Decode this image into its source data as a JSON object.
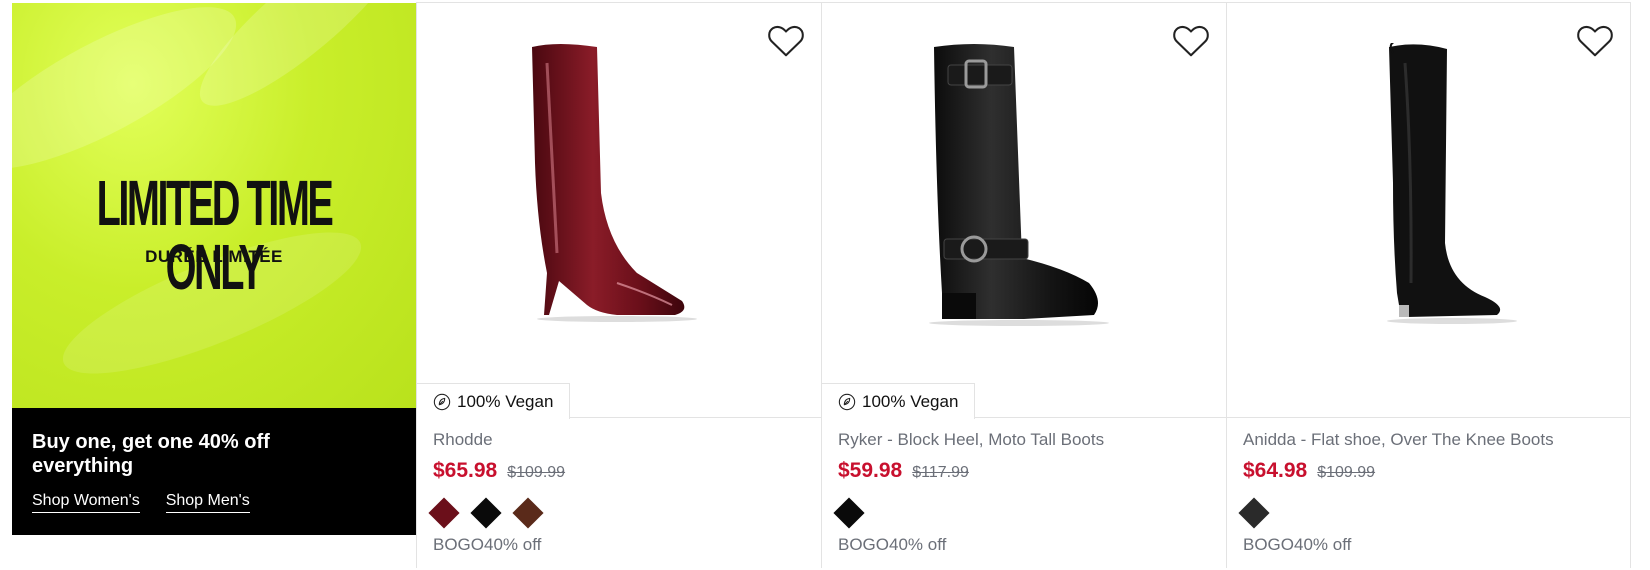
{
  "promo": {
    "headline": "LIMITED TIME ONLY",
    "subheadline": "DURÉE LIMITÉE",
    "offer": "Buy one, get one 40% off everything",
    "shop_women": "Shop Women's",
    "shop_men": "Shop Men's",
    "accent_color": "#c9ee2a"
  },
  "products": [
    {
      "badge": "100% Vegan",
      "name": "Rhodde",
      "price": "$65.98",
      "original_price": "$109.99",
      "swatch_colors": [
        "#6b0f1a",
        "#0a0a0a",
        "#5a2a1a"
      ],
      "promo": "BOGO40% off"
    },
    {
      "badge": "100% Vegan",
      "name": "Ryker - Block Heel, Moto Tall Boots",
      "price": "$59.98",
      "original_price": "$117.99",
      "swatch_colors": [
        "#0a0a0a"
      ],
      "promo": "BOGO40% off"
    },
    {
      "badge": "",
      "name": "Anidda - Flat shoe, Over The Knee Boots",
      "price": "$64.98",
      "original_price": "$109.99",
      "swatch_colors": [
        "#2a2a2a"
      ],
      "promo": "BOGO40% off"
    }
  ],
  "colors": {
    "sale_price": "#c8102e",
    "muted_text": "#6b6f78"
  },
  "icons": [
    "heart-icon",
    "vegan-leaf-icon"
  ]
}
